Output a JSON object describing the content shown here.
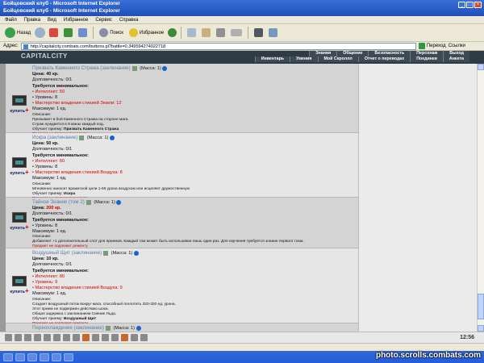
{
  "window": {
    "title1": "Бойцовский клуб - Microsoft Internet Explorer",
    "title2": "Бойцовский клуб - Microsoft Internet Explorer"
  },
  "menu": [
    "Файл",
    "Правка",
    "Вид",
    "Избранное",
    "Сервис",
    "Справка"
  ],
  "toolbar": {
    "back": "Назад",
    "search": "Поиск",
    "favorites": "Избранное"
  },
  "address": {
    "label": "Адрес:",
    "url": "http://capitalcity.combats.com/buttons.pl?battle=0.349594274022718",
    "go": "Переход",
    "links": "Ссылки"
  },
  "site": {
    "logo": "CAPITALCITY",
    "nav_top": [
      "Знания",
      "Общение",
      "Безопасность",
      "Персонаж",
      "Выход"
    ],
    "nav_bottom": [
      "Инвентарь",
      "Умения",
      "Мой Скроллл",
      "Отчет о переводах",
      "Поединки",
      "Анкета"
    ]
  },
  "buy_label": "купить",
  "items": [
    {
      "name": "Призвать Каменного Стража (заклинание)",
      "mass": "(Масса: 1)",
      "price_label": "Цена:",
      "price": "40 кр.",
      "durability": "Долговечность: 0/1",
      "req_title": "Требуется минимальное:",
      "reqs": [
        "• Интеллект: 50",
        "• Уровень: 8",
        "• Мастерство владения стихией Земли: 12"
      ],
      "reqs_red": [
        true,
        false,
        true
      ],
      "max": "Максимум: 1 ед.",
      "desc_title": "Описание:",
      "desc": [
        "Призывает в бой Каменного Стража на стороне мага.",
        "Страж нуждается в 8 маны каждый ход."
      ],
      "learn_label": "Обучает приему:",
      "learn": "Призвать Каменного Стража",
      "warn": "Предмет не подлежит ремонту"
    },
    {
      "name": "Искра (заклинание)",
      "mass": "(Масса: 1)",
      "price_label": "Цена:",
      "price": "50 кр.",
      "durability": "Долговечность: 0/1",
      "req_title": "Требуется минимальное:",
      "reqs": [
        "• Интеллект: 60",
        "• Уровень: 8",
        "• Мастерство владения стихией Воздуха: 8"
      ],
      "reqs_red": [
        true,
        false,
        true
      ],
      "max": "Максимум: 1 ед.",
      "desc_title": "Описание:",
      "desc": [
        "Мгновенно наносит вражеской цели 1-66 урона воздухом или исцеляет дружественную"
      ],
      "learn_label": "Обучает приему:",
      "learn": "Искра",
      "warn": "Предмет не подлежит ремонту"
    },
    {
      "name": "Тайное Знание (том 2)",
      "mass": "(Масса: 1)",
      "price_label": "Цена:",
      "price": "200 кр.",
      "durability": "Долговечность: 0/1",
      "req_title": "Требуется минимальное:",
      "reqs": [
        "• Уровень: 8"
      ],
      "reqs_red": [
        false
      ],
      "max": "Максимум: 1 ед.",
      "desc_title": "Описание:",
      "desc": [
        "Добавляет +1 дополнительный слот для приемов. Каждый том может быть использован лишь один раз. Для изучения требуется знание первого тома."
      ],
      "learn_label": "",
      "learn": "",
      "warn": "Предмет не подлежит ремонту"
    },
    {
      "name": "Воздушный Щит (заклинание)",
      "mass": "(Масса: 1)",
      "price_label": "Цена:",
      "price": "10 кр.",
      "durability": "Долговечность: 0/1",
      "req_title": "Требуется минимальное:",
      "reqs": [
        "• Интеллект: 80",
        "• Уровень: 9",
        "• Мастерство владения стихией Воздуха: 9"
      ],
      "reqs_red": [
        true,
        true,
        true
      ],
      "max": "Максимум: 1 ед.",
      "desc_title": "Описание:",
      "desc": [
        "Создает воздушный поток вокруг мага, способный поглотить 320-320 ед. урона.",
        "Этот прием не подвержен действию шока.",
        "Общая задержка с заклинанием Сияние Льда."
      ],
      "learn_label": "Обучает приему:",
      "learn": "Воздушный Щит",
      "warn": "Предмет не подлежит ремонту"
    },
    {
      "name": "Переохлаждение (заклинание)",
      "mass": "(Масса: 1)"
    }
  ],
  "clock": "12:56",
  "watermark": "photo.scrolls.combats.com"
}
